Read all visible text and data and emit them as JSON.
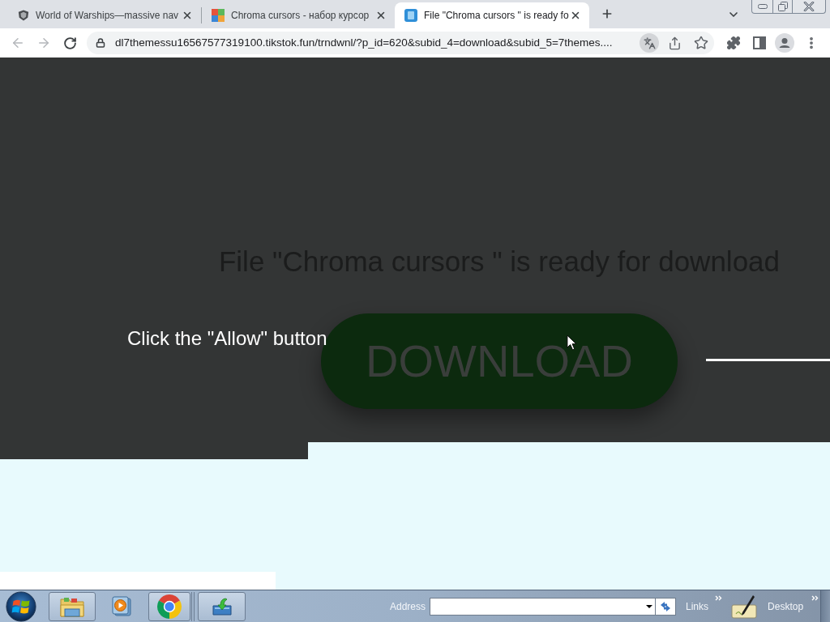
{
  "tabs": [
    {
      "title": "World of Warships—massive nav",
      "selected": false
    },
    {
      "title": "Chroma cursors - набор курсор",
      "selected": false
    },
    {
      "title": "File \"Chroma cursors \" is ready fo",
      "selected": true
    }
  ],
  "address_bar": {
    "url": "dl7themessu16567577319100.tikstok.fun/trndwnl/?p_id=620&subid_4=download&subid_5=7themes...."
  },
  "page": {
    "heading": "File \"Chroma cursors \" is ready for download",
    "download_button": "DOWNLOAD",
    "prompt": "Click the \"Allow\" button"
  },
  "taskbar": {
    "address_label": "Address",
    "links_label": "Links",
    "desktop_label": "Desktop"
  }
}
